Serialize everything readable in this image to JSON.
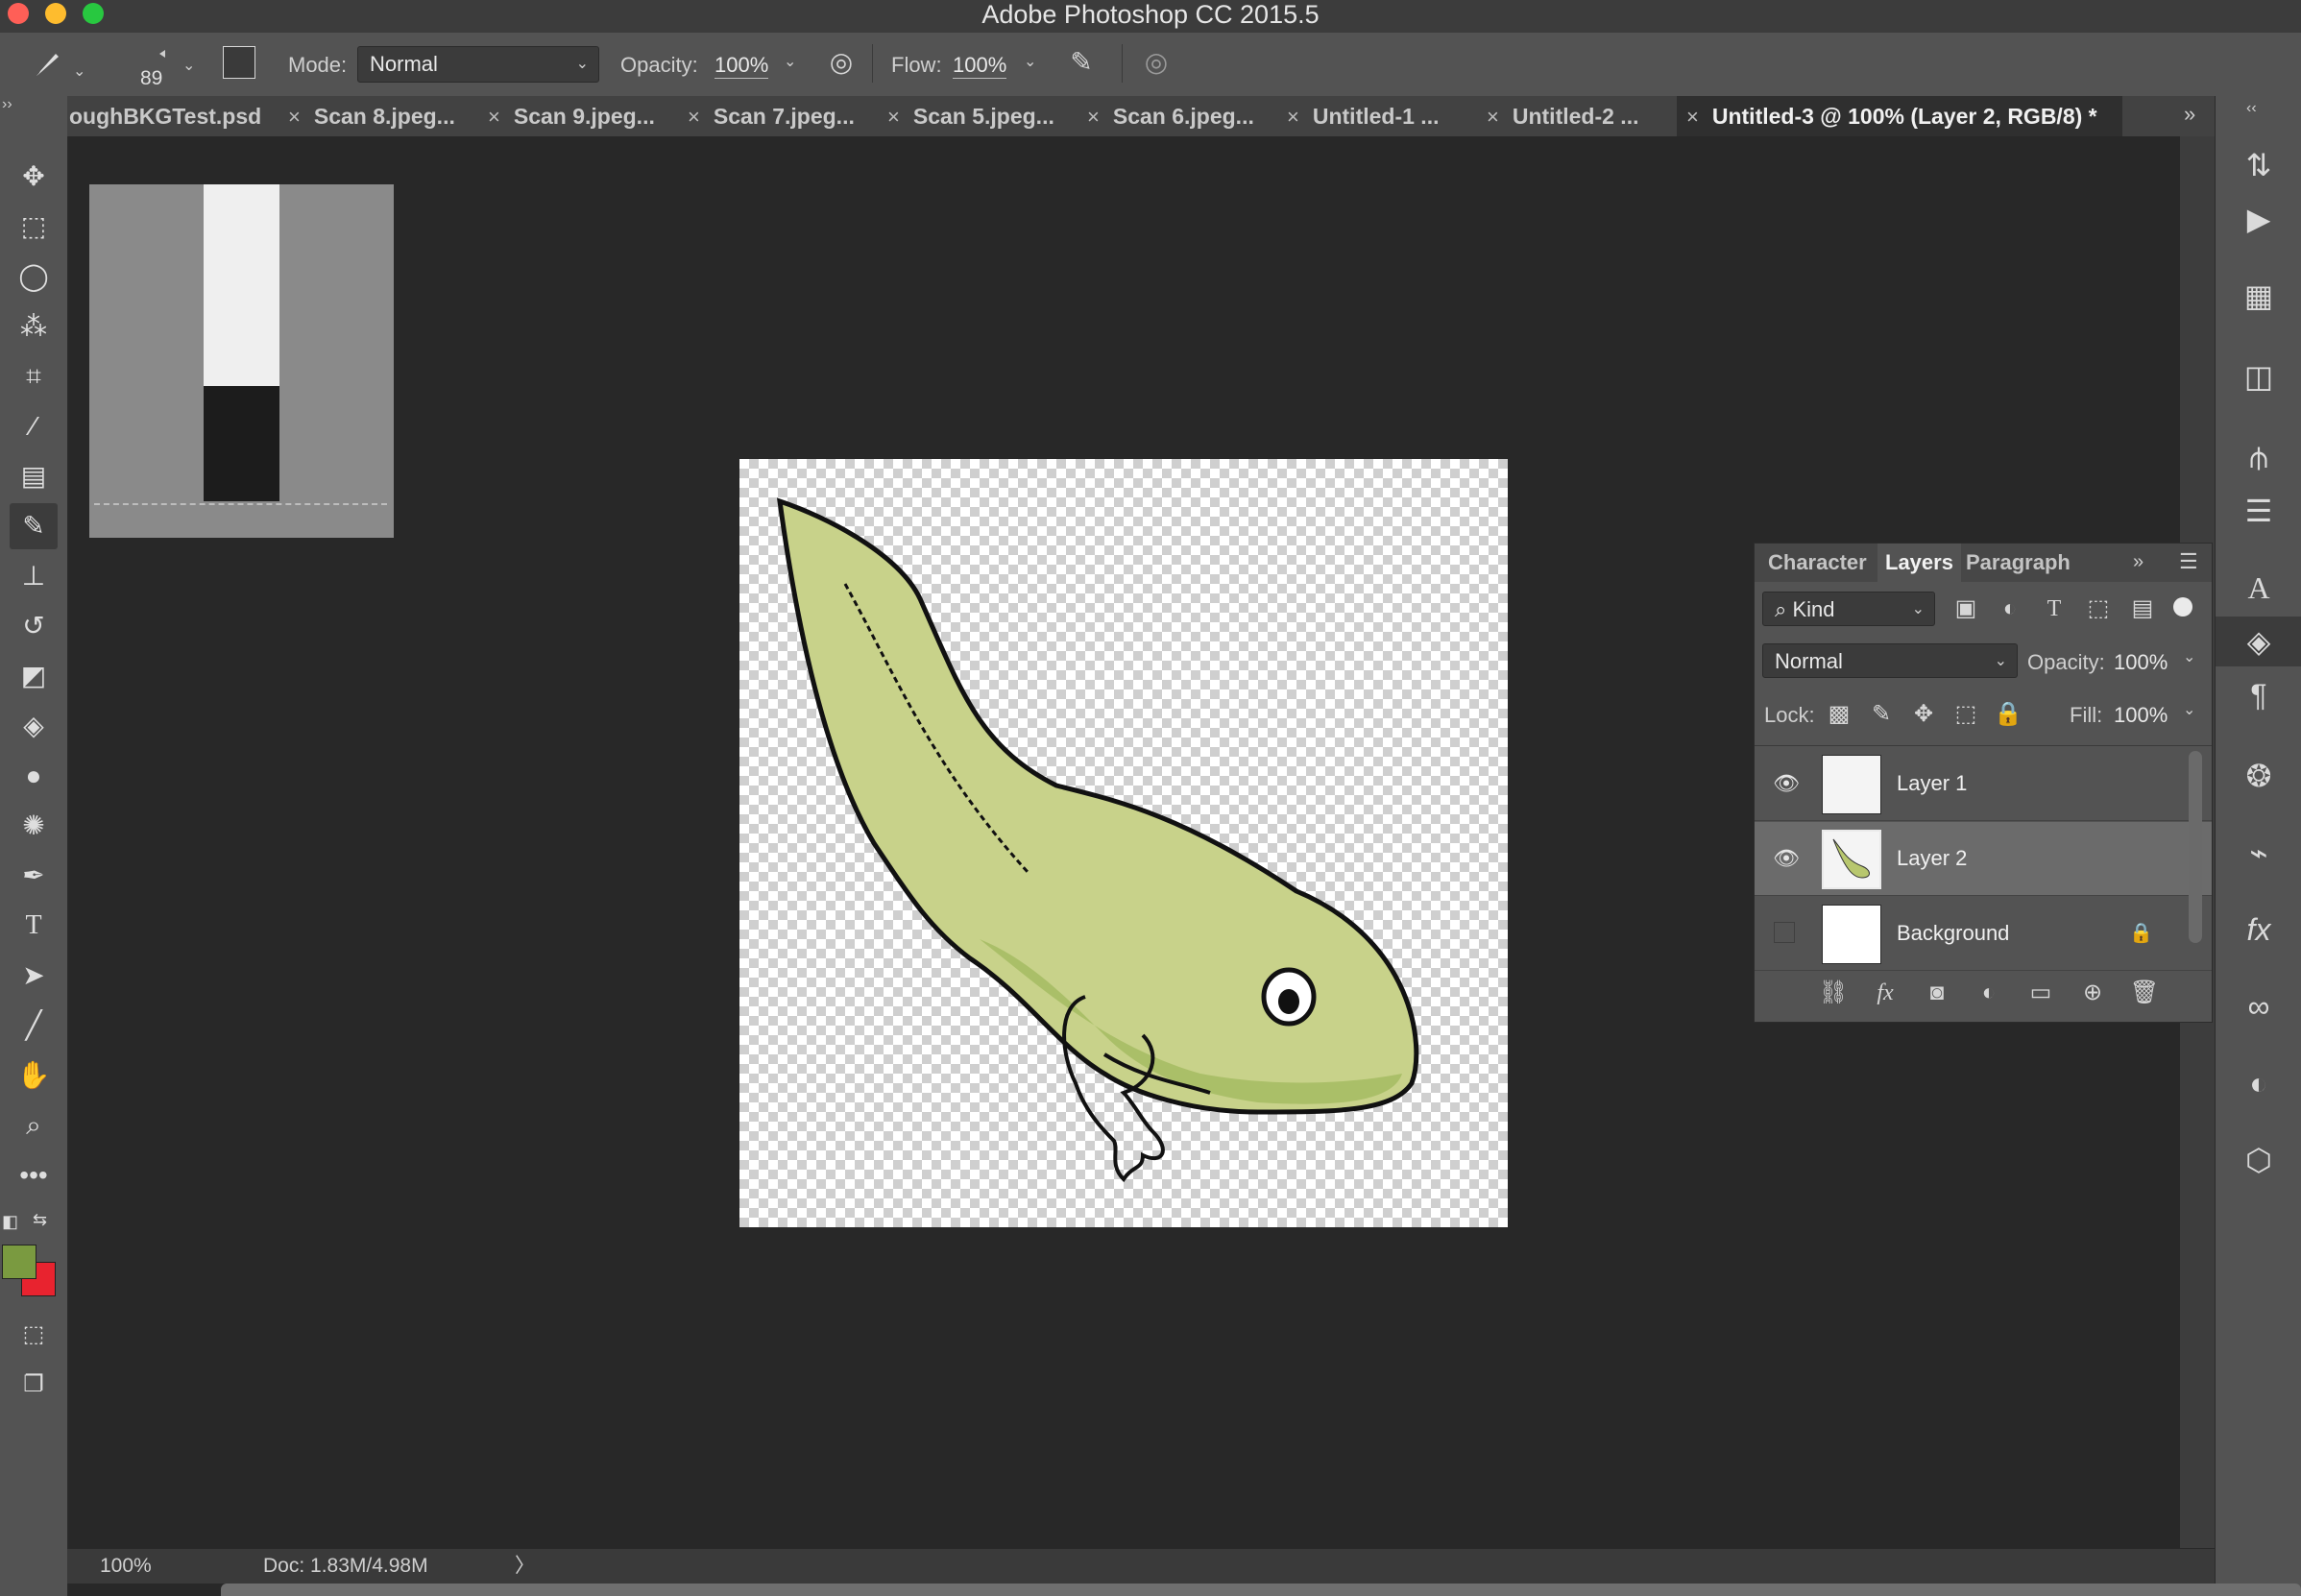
{
  "window": {
    "title": "Adobe Photoshop CC 2015.5",
    "traffic_colors": [
      "#ff5f57",
      "#febc2e",
      "#28c840"
    ]
  },
  "options_bar": {
    "brush_size": "89",
    "mode_label": "Mode:",
    "mode_value": "Normal",
    "opacity_label": "Opacity:",
    "opacity_value": "100%",
    "flow_label": "Flow:",
    "flow_value": "100%"
  },
  "tabs": [
    {
      "label": "oughBKGTest.psd",
      "active": false
    },
    {
      "label": "Scan 8.jpeg...",
      "active": false
    },
    {
      "label": "Scan 9.jpeg...",
      "active": false
    },
    {
      "label": "Scan 7.jpeg...",
      "active": false
    },
    {
      "label": "Scan 5.jpeg...",
      "active": false
    },
    {
      "label": "Scan 6.jpeg...",
      "active": false
    },
    {
      "label": "Untitled-1 ...",
      "active": false
    },
    {
      "label": "Untitled-2 ...",
      "active": false
    },
    {
      "label": "Untitled-3 @ 100% (Layer 2, RGB/8) *",
      "active": true
    }
  ],
  "tab_close_glyph": "×",
  "tools": [
    "move-tool-icon",
    "marquee-tool-icon",
    "lasso-tool-icon",
    "magic-wand-icon",
    "crop-tool-icon",
    "eyedropper-icon",
    "healing-brush-icon",
    "brush-tool-icon",
    "clone-stamp-icon",
    "history-brush-icon",
    "eraser-icon",
    "paint-bucket-icon",
    "blur-tool-icon",
    "dodge-tool-icon",
    "pen-tool-icon",
    "type-tool-icon",
    "path-selection-icon",
    "line-tool-icon",
    "hand-tool-icon",
    "zoom-tool-icon",
    "more-tools-icon"
  ],
  "colors": {
    "foreground": "#7a9a40",
    "background": "#e8232f",
    "tadpole_fill": "#c8d28a",
    "tadpole_shade": "#9cb65a",
    "accent_selected": "#6b6b6b"
  },
  "layers_panel": {
    "tabs": [
      "Character",
      "Layers",
      "Paragraph"
    ],
    "active_tab": "Layers",
    "filter_kind": "Kind",
    "blend_mode": "Normal",
    "opacity_label": "Opacity:",
    "opacity_value": "100%",
    "lock_label": "Lock:",
    "fill_label": "Fill:",
    "fill_value": "100%",
    "layers": [
      {
        "name": "Layer 1",
        "visible": true,
        "selected": false
      },
      {
        "name": "Layer 2",
        "visible": true,
        "selected": true
      },
      {
        "name": "Background",
        "visible": false,
        "selected": false,
        "locked": true
      }
    ]
  },
  "status": {
    "zoom": "100%",
    "doc": "Doc: 1.83M/4.98M",
    "arrow": "〉"
  }
}
